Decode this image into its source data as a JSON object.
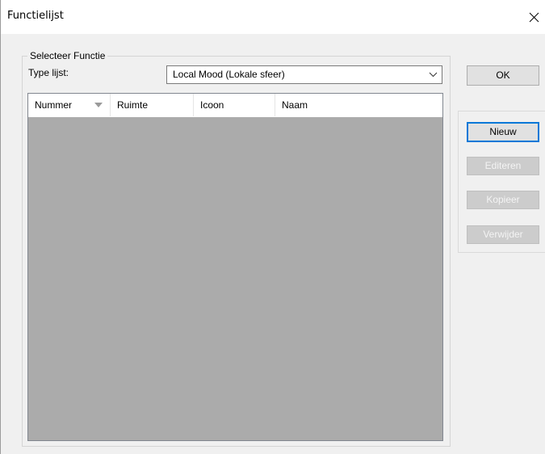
{
  "window": {
    "title": "Functielijst"
  },
  "group": {
    "label": "Selecteer Functie",
    "type_label": "Type lijst:",
    "type_value": "Local Mood (Lokale sfeer)"
  },
  "list": {
    "columns": [
      {
        "label": "Nummer",
        "sorted": true
      },
      {
        "label": "Ruimte"
      },
      {
        "label": "Icoon"
      },
      {
        "label": "Naam"
      }
    ],
    "rows": []
  },
  "buttons": {
    "ok": "OK",
    "new": "Nieuw",
    "edit": "Editeren",
    "copy": "Kopieer",
    "delete": "Verwijder"
  },
  "colors": {
    "dialog_bg": "#f0f0f0",
    "list_bg": "#ababab",
    "focus_border": "#0078d7"
  },
  "icons": {
    "close": "close-icon",
    "dropdown": "chevron-down-icon",
    "sort": "sort-desc-icon"
  }
}
